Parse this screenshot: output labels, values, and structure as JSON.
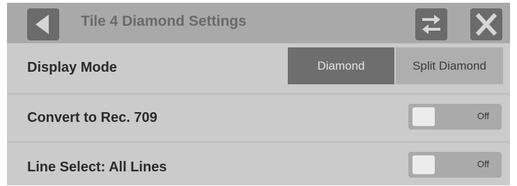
{
  "header": {
    "title": "Tile 4 Diamond Settings",
    "back_icon": "back-arrow-icon",
    "swap_icon": "swap-arrows-icon",
    "close_icon": "close-x-icon"
  },
  "settings": {
    "display_mode": {
      "label": "Display Mode",
      "options": [
        "Diamond",
        "Split Diamond"
      ],
      "selected": "Diamond"
    },
    "convert_rec709": {
      "label": "Convert to Rec. 709",
      "state": "Off"
    },
    "line_select": {
      "label": "Line Select: All Lines",
      "state": "Off"
    }
  },
  "colors": {
    "header_bg": "#a9a9a9",
    "panel_bg": "#cacaca",
    "selected_segment": "#6e6e6e",
    "unselected_segment": "#aeaeae",
    "icon_button": "#6b6b6b"
  }
}
